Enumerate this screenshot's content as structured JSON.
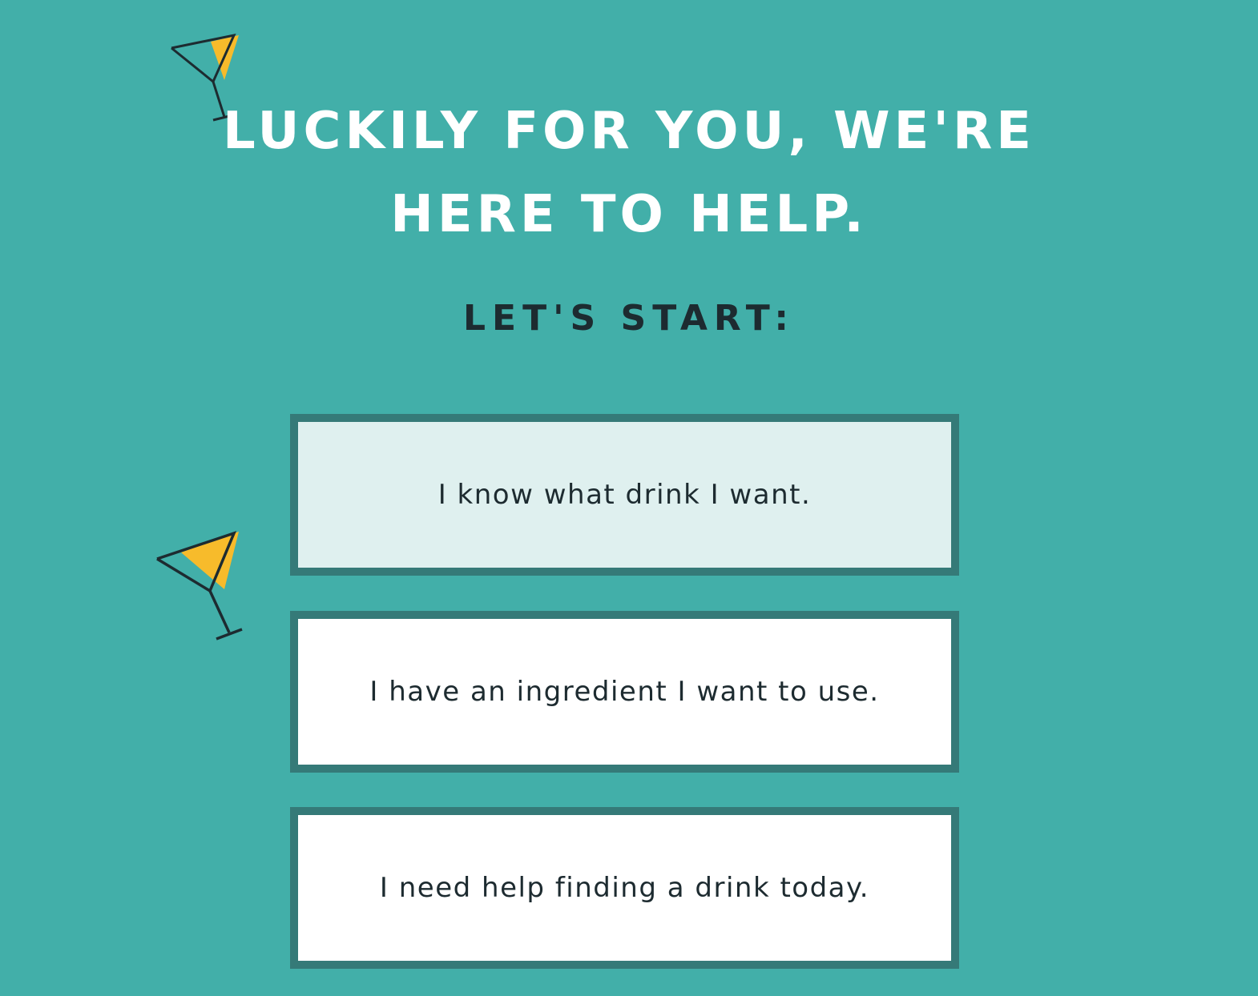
{
  "hero": {
    "headline_line1": "LUCKILY FOR YOU, WE'RE",
    "headline_line2": "HERE TO HELP.",
    "subheading": "LET'S START:"
  },
  "options": [
    {
      "label": "I know what drink I want.",
      "state": "hover"
    },
    {
      "label": "I have an ingredient I want to use.",
      "state": "default"
    },
    {
      "label": "I need help finding a drink today.",
      "state": "default"
    }
  ],
  "decorations": [
    {
      "icon": "martini-glass-icon"
    },
    {
      "icon": "martini-glass-icon"
    }
  ],
  "colors": {
    "background": "#42afa9",
    "headline_text": "#ffffff",
    "dark_text": "#1d2b30",
    "option_border": "#357a78",
    "option_bg": "#ffffff",
    "option_bg_hover": "#dff0ef",
    "glass_fill": "#f7bb2b",
    "glass_stroke": "#1d2b30"
  }
}
